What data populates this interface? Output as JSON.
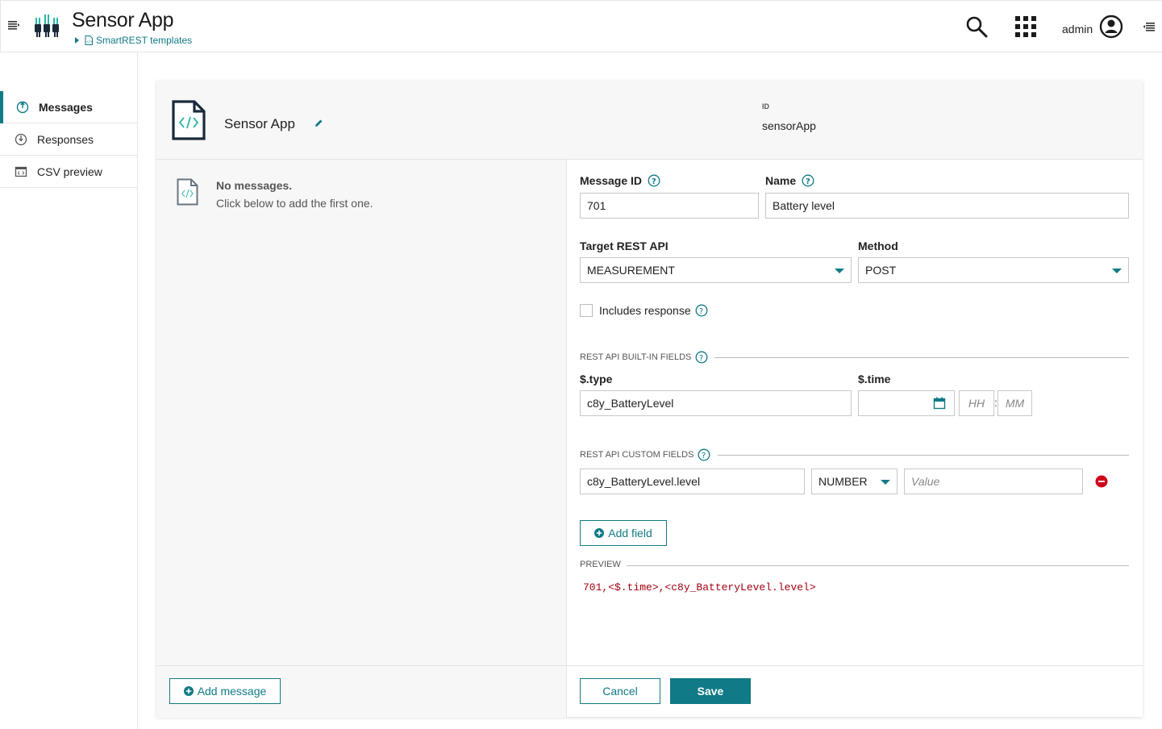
{
  "header": {
    "app_title": "Sensor App",
    "breadcrumb": "SmartREST templates",
    "user": "admin"
  },
  "sidebar": {
    "items": [
      {
        "label": "Messages",
        "active": true
      },
      {
        "label": "Responses",
        "active": false
      },
      {
        "label": "CSV preview",
        "active": false
      }
    ]
  },
  "card": {
    "title": "Sensor App",
    "id_label": "ID",
    "id_value": "sensorApp"
  },
  "messages_list": {
    "empty_title": "No messages.",
    "empty_subtitle": "Click below to add the first one.",
    "add_message_label": "Add message"
  },
  "form": {
    "message_id_label": "Message ID",
    "message_id_value": "701",
    "name_label": "Name",
    "name_value": "Battery level",
    "target_api_label": "Target REST API",
    "target_api_value": "MEASUREMENT",
    "method_label": "Method",
    "method_value": "POST",
    "includes_response_label": "Includes response",
    "includes_response_checked": false,
    "builtin_section": "REST API BUILT-IN FIELDS",
    "type_label": "$.type",
    "type_value": "c8y_BatteryLevel",
    "time_label": "$.time",
    "time_date_value": "",
    "time_hh_placeholder": "HH",
    "time_mm_placeholder": "MM",
    "time_separator": ":",
    "custom_section": "REST API CUSTOM FIELDS",
    "custom_field_path": "c8y_BatteryLevel.level",
    "custom_field_type": "NUMBER",
    "custom_field_value_placeholder": "Value",
    "add_field_label": "Add field",
    "preview_section": "PREVIEW",
    "preview_value": "701,<$.time>,<c8y_BatteryLevel.level>",
    "cancel_label": "Cancel",
    "save_label": "Save"
  },
  "colors": {
    "accent": "#107a86",
    "danger": "#d0021b",
    "preview_text": "#a00010"
  }
}
